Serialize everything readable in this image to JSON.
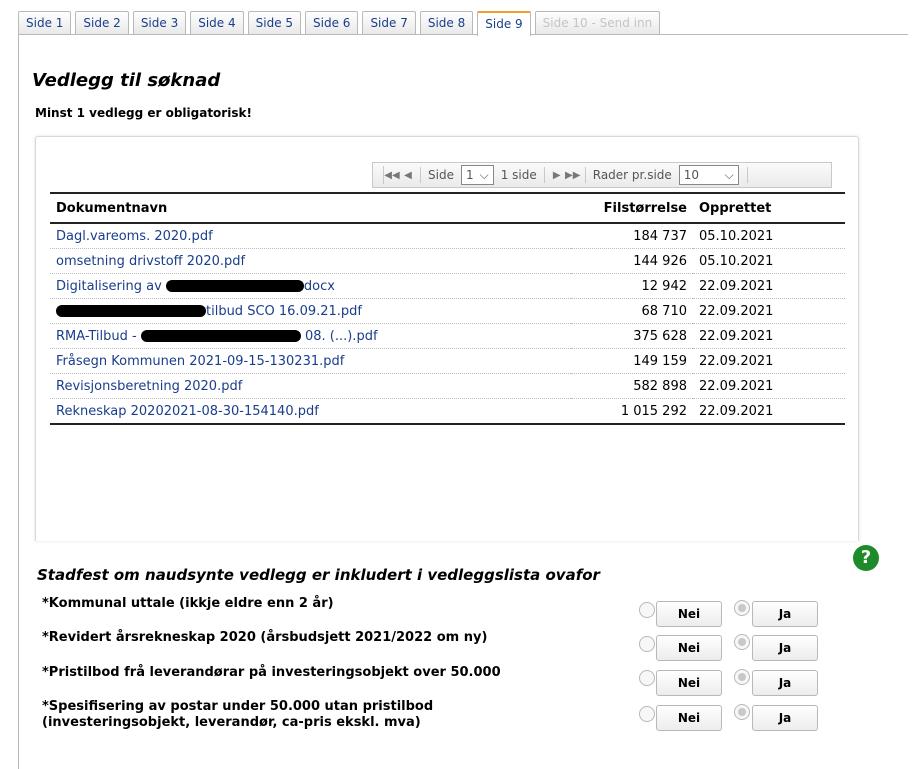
{
  "tabs": [
    {
      "label": "Side 1"
    },
    {
      "label": "Side 2"
    },
    {
      "label": "Side 3"
    },
    {
      "label": "Side 4"
    },
    {
      "label": "Side 5"
    },
    {
      "label": "Side 6"
    },
    {
      "label": "Side 7"
    },
    {
      "label": "Side 8"
    },
    {
      "label": "Side 9",
      "active": true
    },
    {
      "label": "Side 10 - Send inn",
      "disabled": true
    }
  ],
  "page_title": "Vedlegg til søknad",
  "page_subtitle": "Minst 1 vedlegg er obligatorisk!",
  "pager": {
    "side_label": "Side",
    "page_value": "1",
    "pages_text": "1 side",
    "rows_label": "Rader pr.side",
    "rows_value": "10"
  },
  "table": {
    "headers": {
      "name": "Dokumentnavn",
      "size": "Filstørrelse",
      "created": "Opprettet"
    },
    "rows": [
      {
        "name": "Dagl.vareoms. 2020.pdf",
        "size": "184 737",
        "created": "05.10.2021"
      },
      {
        "name": "omsetning drivstoff 2020.pdf",
        "size": "144 926",
        "created": "05.10.2021"
      },
      {
        "name_pre": "Digitalisering av ",
        "name_post": "docx",
        "size": "12 942",
        "created": "22.09.2021"
      },
      {
        "name_pre": "",
        "name_post": "tilbud SCO 16.09.21.pdf",
        "size": "68 710",
        "created": "22.09.2021"
      },
      {
        "name_pre": "RMA-Tilbud - ",
        "name_post": " 08. (...).pdf",
        "size": "375 628",
        "created": "22.09.2021"
      },
      {
        "name": "Fråsegn Kommunen 2021-09-15-130231.pdf",
        "size": "149 159",
        "created": "22.09.2021"
      },
      {
        "name": "Revisjonsberetning 2020.pdf",
        "size": "582 898",
        "created": "22.09.2021"
      },
      {
        "name": "Rekneskap 20202021-08-30-154140.pdf",
        "size": "1 015 292",
        "created": "22.09.2021"
      }
    ]
  },
  "help_icon": "?",
  "confirm": {
    "title": "Stadfest om naudsynte vedlegg er inkludert i vedleggslista ovafor",
    "no_label": "Nei",
    "yes_label": "Ja",
    "questions": [
      {
        "text": "*Kommunal uttale (ikkje eldre enn 2 år)"
      },
      {
        "text": "*Revidert årsrekneskap 2020 (årsbudsjett 2021/2022 om ny)"
      },
      {
        "text": "*Pristilbod frå leverandørar på investeringsobjekt over 50.000"
      },
      {
        "text": "*Spesifisering av postar under 50.000 utan pristilbod",
        "text2": "(investeringsobjekt, leverandør, ca-pris ekskl. mva)"
      }
    ]
  },
  "colors": {
    "link": "#1a3e8c",
    "active_tab_accent": "#f0a030",
    "help": "#1f8a2a"
  }
}
